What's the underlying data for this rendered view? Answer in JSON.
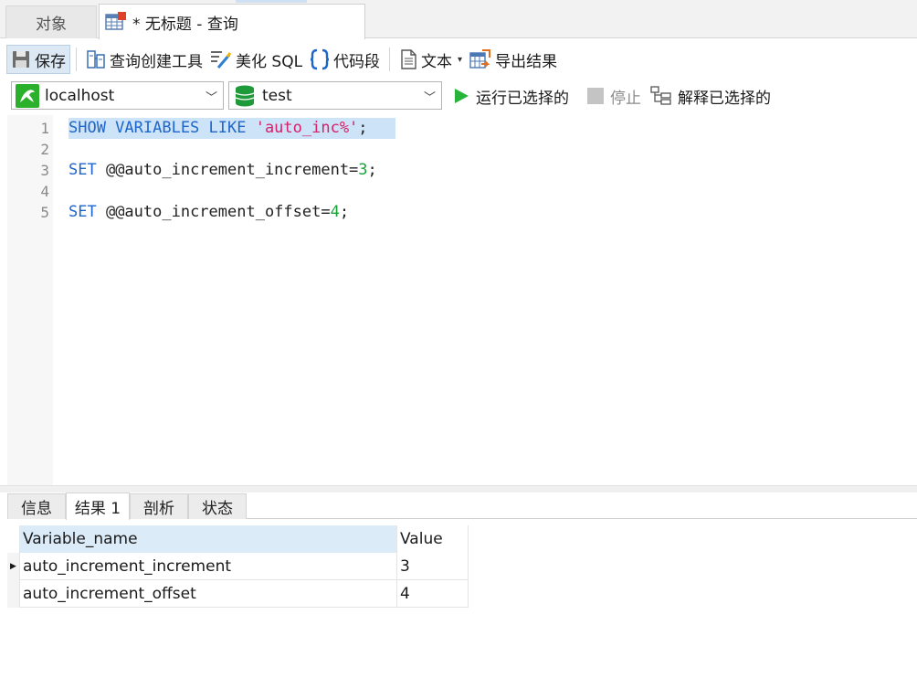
{
  "tabs": {
    "objects_label": "对象",
    "query_label": "* 无标题 - 查询"
  },
  "toolbar": {
    "save_label": "保存",
    "query_builder_label": "查询创建工具",
    "beautify_label": "美化 SQL",
    "snippet_label": "代码段",
    "text_label": "文本",
    "export_label": "导出结果"
  },
  "connection": {
    "server": "localhost",
    "database": "test",
    "run_label": "运行已选择的",
    "stop_label": "停止",
    "explain_label": "解释已选择的"
  },
  "editor": {
    "line_numbers": [
      "1",
      "2",
      "3",
      "4",
      "5"
    ],
    "line1": {
      "kw1": "SHOW VARIABLES LIKE ",
      "str": "'auto_inc%'",
      "end": ";"
    },
    "line3": {
      "kw": "SET",
      "var": " @@auto_increment_increment=",
      "num": "3",
      "end": ";"
    },
    "line5": {
      "kw": "SET",
      "var": " @@auto_increment_offset=",
      "num": "4",
      "end": ";"
    }
  },
  "result_tabs": [
    "信息",
    "结果 1",
    "剖析",
    "状态"
  ],
  "result": {
    "columns": [
      "Variable_name",
      "Value"
    ],
    "rows": [
      [
        "auto_increment_increment",
        "3"
      ],
      [
        "auto_increment_offset",
        "4"
      ]
    ]
  },
  "colors": {
    "keyword": "#1f66cc",
    "string": "#d6206a",
    "number": "#19a339",
    "selection": "#cde3f7",
    "run_green": "#27b43a"
  },
  "icons": {
    "save": "floppy-disk-icon",
    "query_builder": "query-builder-icon",
    "beautify": "magic-wand-icon",
    "snippet": "braces-icon",
    "text": "document-icon",
    "export": "export-table-icon",
    "server": "mysql-dolphin-icon",
    "database": "database-icon",
    "run": "play-icon",
    "stop": "stop-icon",
    "explain": "explain-tree-icon"
  }
}
